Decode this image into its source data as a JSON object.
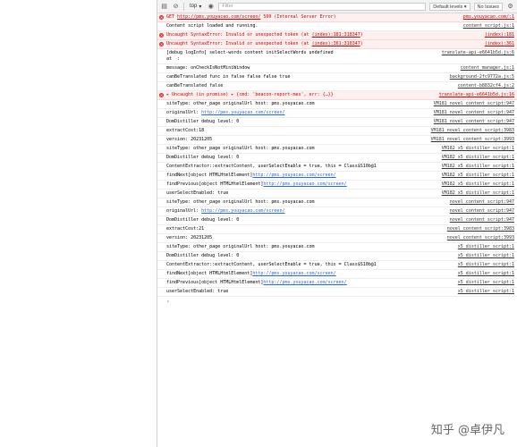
{
  "toolbar": {
    "context": "top",
    "filter_placeholder": "Filter",
    "levels": "Default levels ▾",
    "issues": "No Issues"
  },
  "rows": [
    {
      "type": "error",
      "msg_parts": [
        {
          "t": "GET "
        },
        {
          "t": "http://pms.youyacao.com/screen/",
          "link": true
        },
        {
          "t": " 500 (Internal Server Error)"
        }
      ],
      "src": "pms.youyacao.com/:1"
    },
    {
      "type": "log",
      "msg_parts": [
        {
          "t": "Content script loaded and running."
        }
      ],
      "src": "content_script.js:1"
    },
    {
      "type": "error",
      "msg_parts": [
        {
          "t": "Uncaught SyntaxError: Invalid or unexpected token (at "
        },
        {
          "t": "(index):181:318347",
          "link": true
        },
        {
          "t": ")"
        }
      ],
      "src": "(index):181"
    },
    {
      "type": "error",
      "msg_parts": [
        {
          "t": "Uncaught SyntaxError: Invalid or unexpected token (at "
        },
        {
          "t": "(index):361:318347",
          "link": true
        },
        {
          "t": ")"
        }
      ],
      "src": "(index):361"
    },
    {
      "type": "log",
      "msg_parts": [
        {
          "t": "[debug logInfo] select-words content initSelectWords undefined\nat  :"
        }
      ],
      "src": "translate-api-e6641b5d.js:6"
    },
    {
      "type": "log",
      "msg_parts": [
        {
          "t": "message: onCheckIsNotMiniWindow"
        }
      ],
      "src": "content_manager.js:1"
    },
    {
      "type": "log",
      "msg_parts": [
        {
          "t": "canBeTranslated func in false false false true"
        }
      ],
      "src": "background-2fc9772a.js:5"
    },
    {
      "type": "log",
      "msg_parts": [
        {
          "t": "canBeTranslated false"
        }
      ],
      "src": "content-b8832cf4.js:2"
    },
    {
      "type": "error",
      "msg_parts": [
        {
          "t": "▸ Uncaught (in promise) ▸ {cmd: 'beacon-report-mes', err: {…}}"
        }
      ],
      "src": "translate-api-e6641b5d.js:16"
    },
    {
      "type": "log",
      "msg_parts": [
        {
          "t": "siteType: other_page originalUrl host: pms.youyacao.com"
        }
      ],
      "src": "VM181 novel_content_script:947"
    },
    {
      "type": "log",
      "msg_parts": [
        {
          "t": "originalUrl: "
        },
        {
          "t": "http://pms.youyacao.com/screen/",
          "link": true
        }
      ],
      "src": "VM181 novel_content_script:947"
    },
    {
      "type": "log",
      "msg_parts": [
        {
          "t": "DomDistiller debug level: 0"
        }
      ],
      "src": "VM181 novel_content_script:947"
    },
    {
      "type": "log",
      "msg_parts": [
        {
          "t": "extractCost:18"
        }
      ],
      "src": "VM181 novel_content_script:3983"
    },
    {
      "type": "log",
      "msg_parts": [
        {
          "t": "version: 20231205"
        }
      ],
      "src": "VM181 novel_content_script:3993"
    },
    {
      "type": "log",
      "msg_parts": [
        {
          "t": "siteType: other_page originalUrl host: pms.youyacao.com"
        }
      ],
      "src": "VM182 x5_distiller_script:1"
    },
    {
      "type": "log",
      "msg_parts": [
        {
          "t": "DomDistiller debug level: 0"
        }
      ],
      "src": "VM182 x5_distiller_script:1"
    },
    {
      "type": "log",
      "msg_parts": [
        {
          "t": "ContentExtractor::extractContent, userSelectEnable = true, this = Class$S10b@1"
        }
      ],
      "src": "VM182 x5_distiller_script:1"
    },
    {
      "type": "log",
      "msg_parts": [
        {
          "t": "findNext[object HTMLHtmlElement]"
        },
        {
          "t": "http://pms.youyacao.com/screen/",
          "link": true
        }
      ],
      "src": "VM182 x5_distiller_script:1"
    },
    {
      "type": "log",
      "msg_parts": [
        {
          "t": "findPrevious[object HTMLHtmlElement]"
        },
        {
          "t": "http://pms.youyacao.com/screen/",
          "link": true
        }
      ],
      "src": "VM182 x5_distiller_script:1"
    },
    {
      "type": "log",
      "msg_parts": [
        {
          "t": "userSelectEnabled: true"
        }
      ],
      "src": "VM182 x5_distiller_script:1"
    },
    {
      "type": "log",
      "msg_parts": [
        {
          "t": "siteType: other_page originalUrl host: pms.youyacao.com"
        }
      ],
      "src": "novel_content_script:947"
    },
    {
      "type": "log",
      "msg_parts": [
        {
          "t": "originalUrl: "
        },
        {
          "t": "http://pms.youyacao.com/screen/",
          "link": true
        }
      ],
      "src": "novel_content_script:947"
    },
    {
      "type": "log",
      "msg_parts": [
        {
          "t": "DomDistiller debug level: 0"
        }
      ],
      "src": "novel_content_script:947"
    },
    {
      "type": "log",
      "msg_parts": [
        {
          "t": "extractCost:21"
        }
      ],
      "src": "novel_content_script:3983"
    },
    {
      "type": "log",
      "msg_parts": [
        {
          "t": "version: 20231205"
        }
      ],
      "src": "novel_content_script:3993"
    },
    {
      "type": "log",
      "msg_parts": [
        {
          "t": "siteType: other_page originalUrl host: pms.youyacao.com"
        }
      ],
      "src": "x5_distiller_script:1"
    },
    {
      "type": "log",
      "msg_parts": [
        {
          "t": "DomDistiller debug level: 0"
        }
      ],
      "src": "x5_distiller_script:1"
    },
    {
      "type": "log",
      "msg_parts": [
        {
          "t": "ContentExtractor::extractContent, userSelectEnable = true, this = Class$S10b@1"
        }
      ],
      "src": "x5_distiller_script:1"
    },
    {
      "type": "log",
      "msg_parts": [
        {
          "t": "findNext[object HTMLHtmlElement]"
        },
        {
          "t": "http://pms.youyacao.com/screen/",
          "link": true
        }
      ],
      "src": "x5_distiller_script:1"
    },
    {
      "type": "log",
      "msg_parts": [
        {
          "t": "findPrevious[object HTMLHtmlElement]"
        },
        {
          "t": "http://pms.youyacao.com/screen/",
          "link": true
        }
      ],
      "src": "x5_distiller_script:1"
    },
    {
      "type": "log",
      "msg_parts": [
        {
          "t": "userSelectEnabled: true"
        }
      ],
      "src": "x5_distiller_script:1"
    }
  ],
  "prompt_symbol": "›",
  "watermark": "知乎 @卓伊凡"
}
